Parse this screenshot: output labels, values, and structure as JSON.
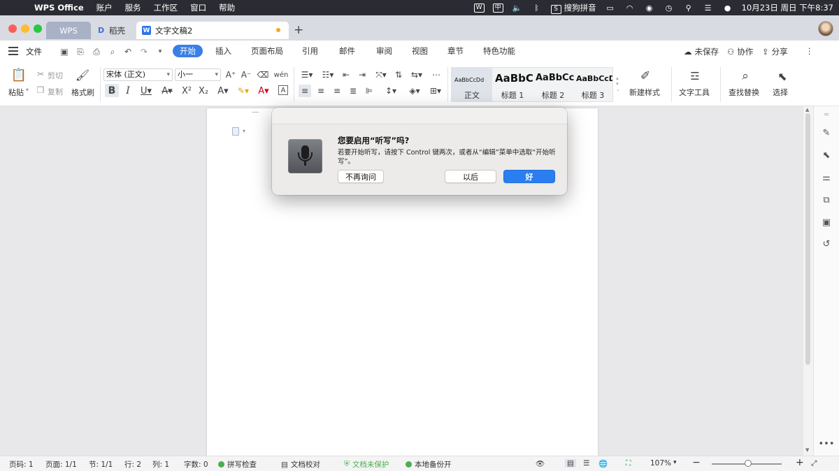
{
  "menubar": {
    "app_name": "WPS Office",
    "items": [
      "账户",
      "服务",
      "工作区",
      "窗口",
      "帮助"
    ],
    "ime_label": "中",
    "input_method": "搜狗拼音",
    "datetime": "10月23日 周日 下午8:37"
  },
  "tabs": {
    "home": "WPS",
    "daoke": "稻壳",
    "document": "文字文稿2"
  },
  "ribbon": {
    "file": "文件",
    "tabs": [
      "开始",
      "插入",
      "页面布局",
      "引用",
      "邮件",
      "审阅",
      "视图",
      "章节",
      "特色功能"
    ],
    "unsaved": "未保存",
    "collaborate": "协作",
    "share": "分享"
  },
  "toolbar": {
    "paste": "粘贴",
    "cut": "剪切",
    "copy": "复制",
    "format_painter": "格式刷",
    "font_name": "宋体 (正文)",
    "font_size": "小一",
    "styles": [
      {
        "sample": "AaBbCcDd",
        "name": "正文"
      },
      {
        "sample": "AaBbC",
        "name": "标题 1"
      },
      {
        "sample": "AaBbCc",
        "name": "标题 2"
      },
      {
        "sample": "AaBbCcD",
        "name": "标题 3"
      }
    ],
    "new_style": "新建样式",
    "text_tools": "文字工具",
    "find_replace": "查找替换",
    "select": "选择"
  },
  "dialog": {
    "title": "您要启用“听写”吗?",
    "message": "若要开始听写，请按下 Control 键两次，或者从“编辑”菜单中选取“开始听写”。",
    "dont_ask": "不再询问",
    "later": "以后",
    "ok": "好"
  },
  "status": {
    "page": "页码: 1",
    "pages": "页面: 1/1",
    "section": "节: 1/1",
    "row": "行: 2",
    "col": "列: 1",
    "words": "字数: 0",
    "spell": "拼写检查",
    "proofread": "文档校对",
    "protect": "文档未保护",
    "backup": "本地备份开",
    "zoom": "107%"
  }
}
